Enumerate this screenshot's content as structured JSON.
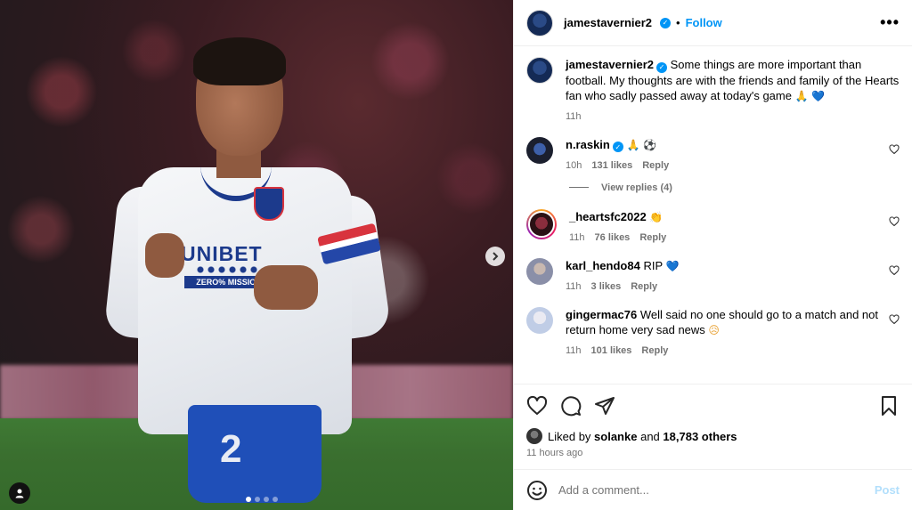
{
  "post": {
    "author": "jamestavernier2",
    "follow_label": "Follow",
    "separator": "•",
    "more_icon": "more-horizontal-icon",
    "caption": "Some things are more important than football. My thoughts are with the friends and family of the Hearts fan who sadly passed away at today's game",
    "caption_time": "11h",
    "image_carousel": {
      "count": 4,
      "active": 0
    }
  },
  "comments": [
    {
      "user": "n.raskin",
      "verified": true,
      "text": "",
      "time": "10h",
      "likes": "131 likes",
      "reply": "Reply",
      "emoji": [
        "🙏",
        "⚽"
      ],
      "view_replies": "View replies (4)"
    },
    {
      "user": "_heartsfc2022",
      "verified": false,
      "text": "",
      "time": "11h",
      "likes": "76 likes",
      "reply": "Reply",
      "emoji": [
        "👏"
      ]
    },
    {
      "user": "karl_hendo84",
      "verified": false,
      "text": "RIP",
      "time": "11h",
      "likes": "3 likes",
      "reply": "Reply",
      "emoji": [
        "💙"
      ]
    },
    {
      "user": "gingermac76",
      "verified": false,
      "text": "Well said no one should go to a match and not return home very sad news",
      "time": "11h",
      "likes": "101 likes",
      "reply": "Reply",
      "emoji": [
        "😥"
      ]
    }
  ],
  "likes_line": {
    "prefix": "Liked by",
    "user": "solanke",
    "and": "and",
    "others": "18,783 others"
  },
  "time_ago": "11 hours ago",
  "add_comment": {
    "placeholder": "Add a comment...",
    "post_label": "Post"
  },
  "photo": {
    "sponsor": "UNIBET",
    "mission": "ZERO% MISSION",
    "shorts_number": "2"
  },
  "colors": {
    "accent": "#0095f6",
    "post_disabled": "#b2dffc",
    "muted": "#737373"
  }
}
